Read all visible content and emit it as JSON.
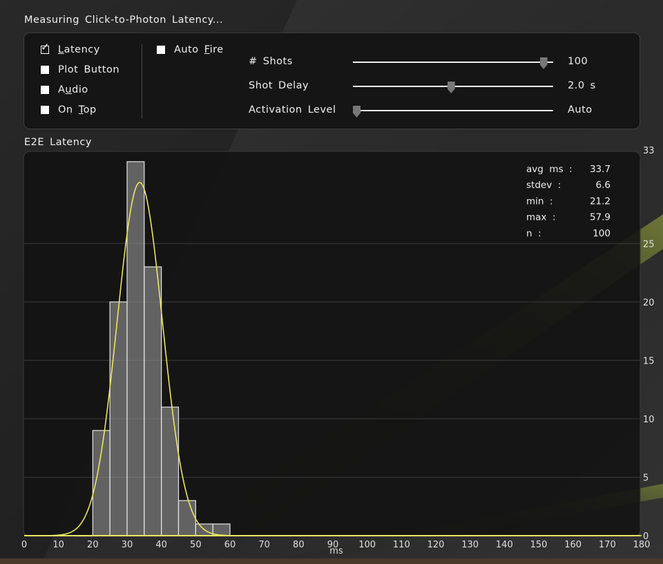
{
  "window": {
    "title": "Measuring  Click-to-Photon  Latency..."
  },
  "controls": {
    "checkboxes": [
      {
        "pre": "",
        "ul": "L",
        "post": "atency",
        "checked": true
      },
      {
        "pre": "Plot  Button",
        "ul": "",
        "post": "",
        "checked": false
      },
      {
        "pre": "A",
        "ul": "u",
        "post": "dio",
        "checked": false
      },
      {
        "pre": "On  ",
        "ul": "T",
        "post": "op",
        "checked": false
      }
    ],
    "auto_fire": {
      "pre": "Auto  ",
      "ul": "F",
      "post": "ire",
      "checked": false
    },
    "sliders": [
      {
        "label": "#  Shots",
        "value": "100",
        "position": 0.97
      },
      {
        "label": "Shot  Delay",
        "value": "2.0  s",
        "position": 0.49
      },
      {
        "label": "Activation  Level",
        "value": "Auto",
        "position": 0.0
      }
    ]
  },
  "section": {
    "title": "E2E  Latency"
  },
  "chart_data": {
    "type": "bar",
    "xlabel": "ms",
    "ylabel": "",
    "xlim": [
      0,
      180
    ],
    "ylim": [
      0,
      33
    ],
    "x_ticks": [
      0,
      10,
      20,
      30,
      40,
      50,
      60,
      70,
      80,
      90,
      100,
      110,
      120,
      130,
      140,
      150,
      160,
      170,
      180
    ],
    "y_ticks": [
      0,
      5,
      10,
      15,
      20,
      25,
      33
    ],
    "gridlines": [
      5,
      10,
      15,
      20,
      25
    ],
    "bins": [
      {
        "start": 15,
        "end": 20,
        "count": 0
      },
      {
        "start": 20,
        "end": 25,
        "count": 9
      },
      {
        "start": 25,
        "end": 30,
        "count": 20
      },
      {
        "start": 30,
        "end": 35,
        "count": 32
      },
      {
        "start": 35,
        "end": 40,
        "count": 23
      },
      {
        "start": 40,
        "end": 45,
        "count": 11
      },
      {
        "start": 45,
        "end": 50,
        "count": 3
      },
      {
        "start": 50,
        "end": 55,
        "count": 1
      },
      {
        "start": 55,
        "end": 60,
        "count": 1
      }
    ],
    "fit_curve": {
      "type": "gaussian",
      "mean": 33.7,
      "stdev": 6.6,
      "n": 100,
      "bin_width": 5,
      "color": "#e8e860"
    },
    "stats": [
      {
        "label": "avg  ms  :",
        "value": "33.7"
      },
      {
        "label": "stdev  :",
        "value": "6.6"
      },
      {
        "label": "min  :",
        "value": "21.2"
      },
      {
        "label": "max  :",
        "value": "57.9"
      },
      {
        "label": "n  :",
        "value": "100"
      }
    ]
  }
}
